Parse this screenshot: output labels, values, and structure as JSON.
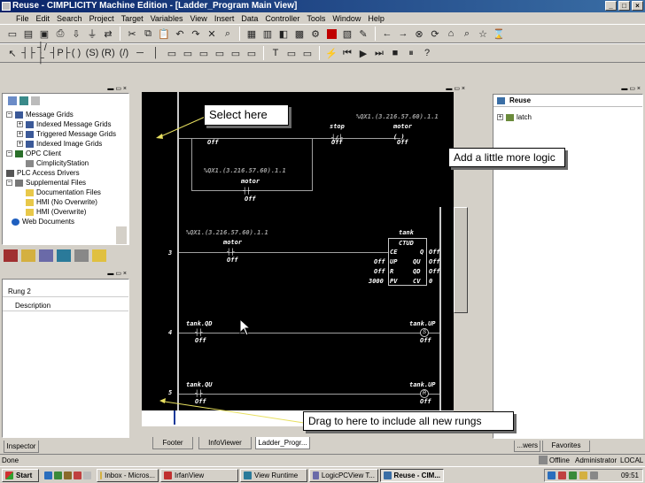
{
  "window": {
    "title": "Reuse - CIMPLICITY Machine Edition - [Ladder_Program Main View]"
  },
  "menu": [
    "File",
    "Edit",
    "Search",
    "Project",
    "Target",
    "Variables",
    "View",
    "Insert",
    "Data",
    "Controller",
    "Tools",
    "Window",
    "Help"
  ],
  "navigator": {
    "items": [
      {
        "label": "Message Grids",
        "level": 1,
        "expander": "−"
      },
      {
        "label": "Indexed Message Grids",
        "level": 2,
        "expander": "+"
      },
      {
        "label": "Triggered Message Grids",
        "level": 2,
        "expander": "+"
      },
      {
        "label": "Indexed Image Grids",
        "level": 2,
        "expander": "+"
      },
      {
        "label": "OPC Client",
        "level": 1,
        "expander": "−"
      },
      {
        "label": "CimplicityStation",
        "level": 2,
        "expander": ""
      },
      {
        "label": "PLC Access Drivers",
        "level": 1,
        "expander": ""
      },
      {
        "label": "Supplemental Files",
        "level": 1,
        "expander": "−"
      },
      {
        "label": "Documentation Files",
        "level": 2,
        "expander": ""
      },
      {
        "label": "HMI (No Overwrite)",
        "level": 2,
        "expander": ""
      },
      {
        "label": "HMI (Overwrite)",
        "level": 2,
        "expander": ""
      },
      {
        "label": "Web Documents",
        "level": 1,
        "expander": ""
      }
    ]
  },
  "inspector": {
    "rung": "Rung 2",
    "description": "Description",
    "tab": "Inspector"
  },
  "ladder": {
    "rung1": {
      "contact1_value": "Off",
      "contact2_label": "stop",
      "contact2_value": "Off",
      "coil_address": "%QX1.(3.216.57.60).1.1",
      "coil_label": "motor",
      "coil_value": "Off",
      "branch_address": "%QX1.(3.216.57.60).1.1",
      "branch_label": "motor",
      "branch_value": "Off"
    },
    "rung3": {
      "number": "3",
      "address": "%QX1.(3.216.57.60).1.1",
      "contact_label": "motor",
      "contact_value": "Off",
      "block_name": "tank",
      "block_type": "CTUD",
      "pins": {
        "ce": "CE",
        "q": "Q",
        "up": "UP",
        "qu": "QU",
        "r": "R",
        "qd": "QD",
        "pv": "PV",
        "cv": "CV"
      },
      "up_value": "Off",
      "r_value": "Off",
      "pv_value": "3000",
      "q_value": "Off",
      "qu_value": "Off",
      "qd_value": "Off",
      "cv_value": "0"
    },
    "rung4": {
      "number": "4",
      "contact_label": "tank.QD",
      "contact_value": "Off",
      "coil_label": "tank.UP",
      "coil_mark": "S",
      "coil_value": "Off"
    },
    "rung5": {
      "number": "5",
      "contact_label": "tank.QU",
      "contact_value": "Off",
      "coil_label": "tank.UP",
      "coil_mark": "R",
      "coil_value": "Off"
    }
  },
  "editor_tabs": [
    "Footer",
    "InfoViewer",
    "Ladder_Progr..."
  ],
  "reuse": {
    "title": "Reuse",
    "items": [
      "latch"
    ],
    "tabs": [
      "...wers",
      "Favorites"
    ]
  },
  "callouts": {
    "select": "Select here",
    "add_logic": "Add a little more logic",
    "drag": "Drag to here to include all new rungs"
  },
  "status": {
    "left": "Done",
    "mode": "Offline",
    "user": "Administrator",
    "location": "LOCAL"
  },
  "taskbar": {
    "start": "Start",
    "buttons": [
      "Inbox - Micros...",
      "IrfanView",
      "View Runtime",
      "LogicPCView T...",
      "Reuse - CIM..."
    ],
    "clock": "09:51"
  },
  "colors": {
    "titlebar": "#0a246a",
    "ladder_bg": "#000000",
    "chrome": "#d4d0c8"
  }
}
